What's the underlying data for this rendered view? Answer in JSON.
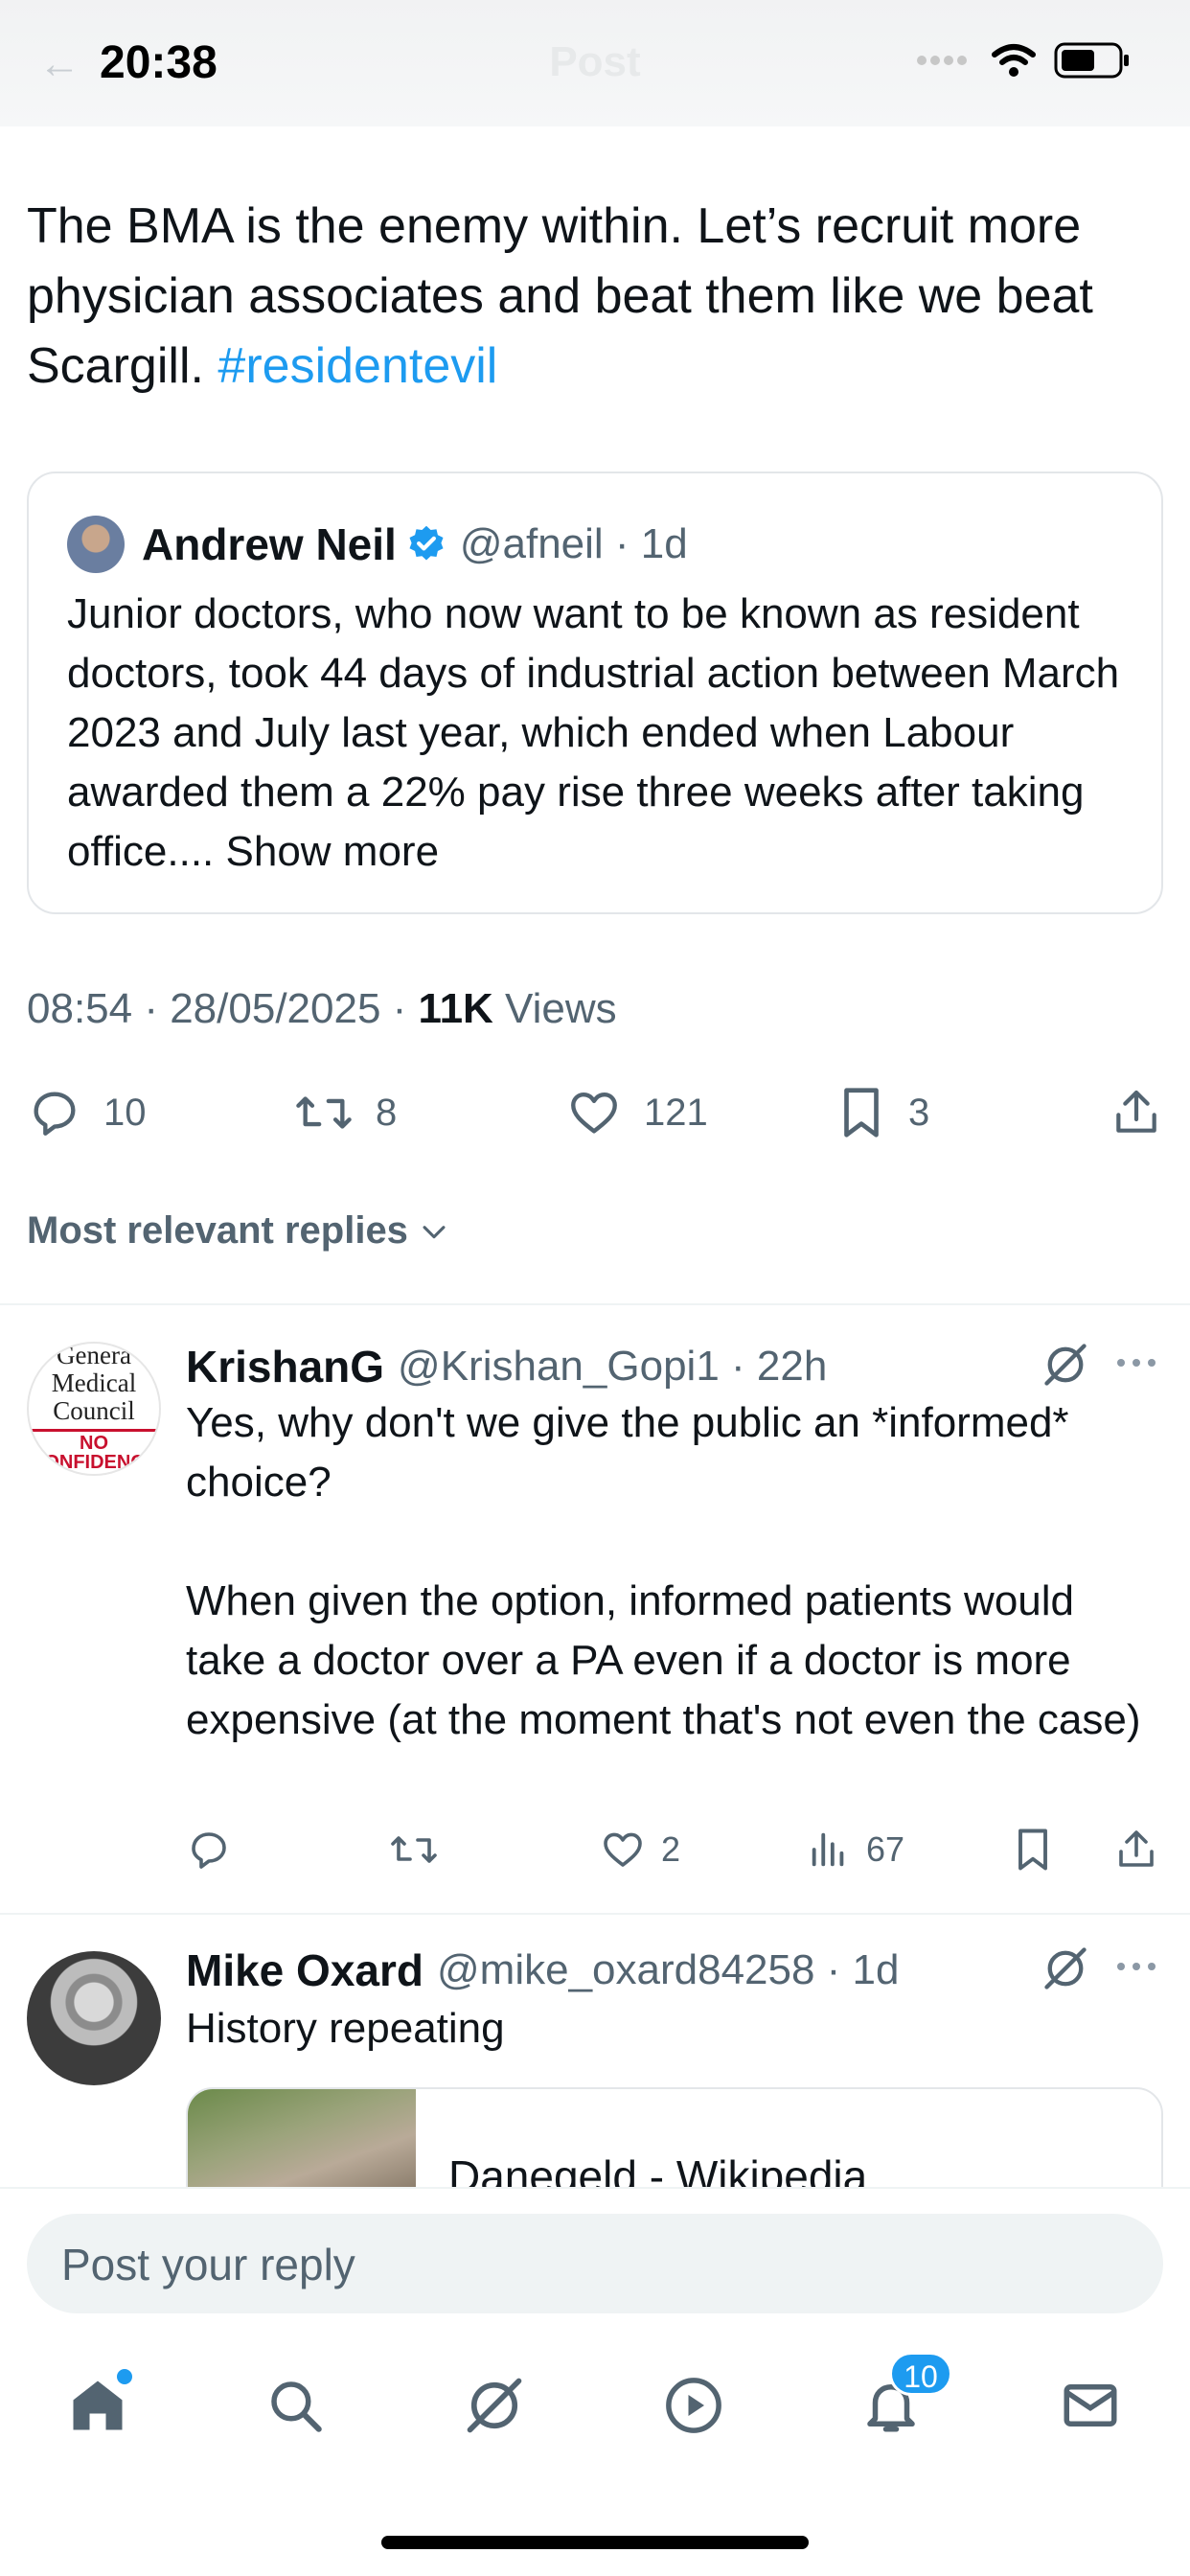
{
  "status_bar": {
    "time": "20:38",
    "header_title": "Post"
  },
  "post": {
    "text": "The BMA is the enemy within. Let’s recruit more physician associates and beat them like we beat Scargill. ",
    "hashtag": "#residentevil",
    "timestamp": "08:54 · 28/05/2025 · ",
    "views_count": "11K",
    "views_label": " Views",
    "replies": "10",
    "reposts": "8",
    "likes": "121",
    "bookmarks": "3"
  },
  "quote": {
    "name": "Andrew Neil",
    "handle": "@afneil · 1d",
    "body": "Junior doctors, who now want to be known as resident doctors, took 44 days of industrial action between March 2023 and July last year, which ended when Labour awarded them a 22%  pay rise three weeks after taking office....",
    "show_more": "Show more"
  },
  "replies_filter": "Most relevant replies",
  "replies": [
    {
      "name": "KrishanG",
      "handle": "@Krishan_Gopi1 · 22h",
      "avatar_lines": [
        "Genera",
        "Medical",
        "Council"
      ],
      "avatar_badge": "NO CONFIDENCE",
      "body": "Yes, why don't we give the public an *informed* choice?\n\nWhen given the option, informed patients would take a doctor over a PA even if a doctor is more expensive (at the moment that's not even the case)",
      "likes": "2",
      "views": "67"
    },
    {
      "name": "Mike Oxard",
      "handle": "@mike_oxard84258 · 1d",
      "body": "History repeating",
      "link_title": "Danegeld - Wikipedia"
    }
  ],
  "compose": {
    "placeholder": "Post your reply"
  },
  "tabbar": {
    "notifications_badge": "10"
  },
  "colors": {
    "accent": "#1d9bf0",
    "secondary_text": "#536471",
    "primary_text": "#0f1419"
  }
}
